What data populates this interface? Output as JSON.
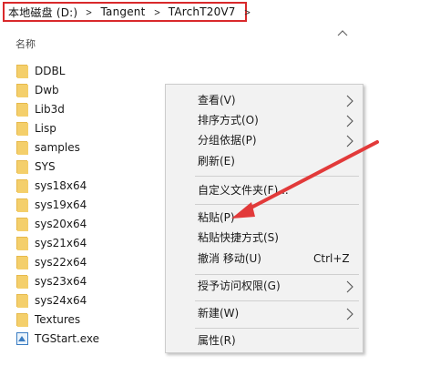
{
  "breadcrumb": {
    "items": [
      "本地磁盘 (D:)",
      "Tangent",
      "TArchT20V7"
    ],
    "separator": ">"
  },
  "column_header": {
    "name": "名称"
  },
  "files": [
    {
      "label": "DDBL",
      "icon": "folder-icon"
    },
    {
      "label": "Dwb",
      "icon": "folder-icon"
    },
    {
      "label": "Lib3d",
      "icon": "folder-icon"
    },
    {
      "label": "Lisp",
      "icon": "folder-icon"
    },
    {
      "label": "samples",
      "icon": "folder-icon"
    },
    {
      "label": "SYS",
      "icon": "folder-icon"
    },
    {
      "label": "sys18x64",
      "icon": "folder-icon"
    },
    {
      "label": "sys19x64",
      "icon": "folder-icon"
    },
    {
      "label": "sys20x64",
      "icon": "folder-icon"
    },
    {
      "label": "sys21x64",
      "icon": "folder-icon"
    },
    {
      "label": "sys22x64",
      "icon": "folder-icon"
    },
    {
      "label": "sys23x64",
      "icon": "folder-icon"
    },
    {
      "label": "sys24x64",
      "icon": "folder-icon"
    },
    {
      "label": "Textures",
      "icon": "folder-icon"
    },
    {
      "label": "TGStart.exe",
      "icon": "exe-icon"
    }
  ],
  "context_menu": {
    "view": "查看(V)",
    "sort_by": "排序方式(O)",
    "group_by": "分组依据(P)",
    "refresh": "刷新(E)",
    "customize_folder": "自定义文件夹(F)...",
    "paste": "粘贴(P)",
    "paste_shortcut": "粘贴快捷方式(S)",
    "undo_move": "撤消 移动(U)",
    "undo_shortcut": "Ctrl+Z",
    "give_access": "授予访问权限(G)",
    "new": "新建(W)",
    "properties": "属性(R)"
  },
  "colors": {
    "highlight_box": "#d9292b",
    "annotation_arrow": "#e23a3a",
    "folder_fill": "#f4cf6b",
    "folder_tab": "#e6b94c",
    "menu_background": "#f2f2f2"
  }
}
